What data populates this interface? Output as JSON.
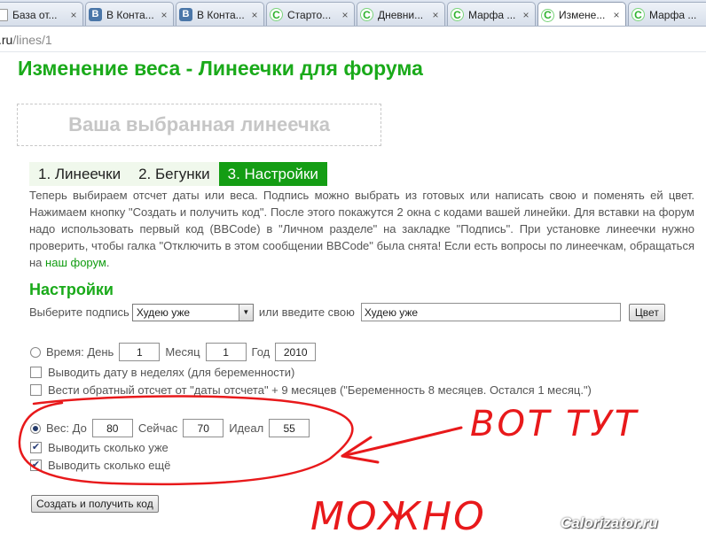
{
  "browser": {
    "tabs": [
      {
        "icon": "page-icon",
        "title": "База от..."
      },
      {
        "icon": "vk-icon",
        "title": "В Конта..."
      },
      {
        "icon": "vk-icon",
        "title": "В Конта..."
      },
      {
        "icon": "calorizator-icon",
        "title": "Старто..."
      },
      {
        "icon": "calorizator-icon",
        "title": "Дневни..."
      },
      {
        "icon": "calorizator-icon",
        "title": "Марфа ..."
      },
      {
        "icon": "calorizator-icon",
        "title": "Измене...",
        "active": true
      },
      {
        "icon": "calorizator-icon",
        "title": "Марфа ..."
      }
    ],
    "close_glyph": "×",
    "url_host": ".ru",
    "url_path": "/lines/1"
  },
  "page": {
    "title": "Изменение веса - Линеечки для форума",
    "preview_text": "Ваша выбранная линеечка",
    "steps": [
      {
        "label": "1. Линеечки"
      },
      {
        "label": "2. Бегунки"
      },
      {
        "label": "3. Настройки",
        "active": true
      }
    ],
    "intro_text": "Теперь выбираем отсчет даты или веса. Подпись можно выбрать из готовых или написать свою и поменять ей цвет. Нажимаем кнопку \"Создать и получить код\". После этого покажутся 2 окна с кодами вашей линейки. Для вставки на форум надо использовать первый код (BBCode) в \"Личном разделе\" на закладке \"Подпись\". При установке линеечки нужно проверить, чтобы галка \"Отключить в этом сообщении BBCode\" была снята! Если есть вопросы по линеечкам, обращаться на",
    "intro_link": "наш форум",
    "intro_end": "."
  },
  "settings": {
    "heading": "Настройки",
    "caption_label": "Выберите подпись",
    "caption_select_value": "Худею уже",
    "caption_or_label": "или введите свою",
    "caption_input_value": "Худею уже",
    "color_button": "Цвет",
    "time": {
      "label": "Время: День",
      "day": "1",
      "month_label": "Месяц",
      "month": "1",
      "year_label": "Год",
      "year": "2010",
      "selected": false
    },
    "weeks_label": "Выводить дату в неделях (для беременности)",
    "countdown_label": "Вести обратный отсчет от \"даты отсчета\" + 9 месяцев (\"Беременность 8 месяцев. Остался 1 месяц.\")",
    "weight": {
      "label": "Вес: До",
      "target": "80",
      "now_label": "Сейчас",
      "now": "70",
      "ideal_label": "Идеал",
      "ideal": "55",
      "selected": true
    },
    "show_lost_label": "Выводить сколько уже",
    "show_left_label": "Выводить сколько ещё",
    "submit_button": "Создать и получить код"
  },
  "annotation": {
    "text1": "ВОТ ТУТ",
    "text2": "МОЖНО",
    "color": "#e8191b"
  },
  "watermark": "Calorizator.ru",
  "colors": {
    "brand_green": "#1aaa1a",
    "active_step": "#149d14"
  }
}
